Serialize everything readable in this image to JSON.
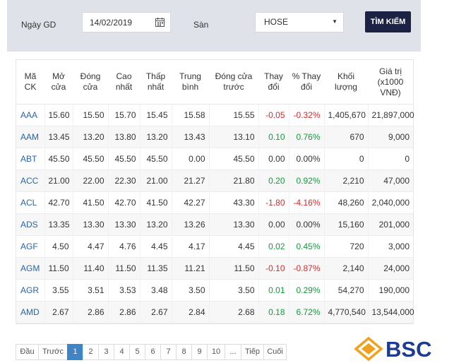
{
  "filter": {
    "date_label": "Ngày GD",
    "date_value": "14/02/2019",
    "exchange_label": "Sàn",
    "exchange_value": "HOSE",
    "search_label": "TÌM KIẾM"
  },
  "table": {
    "headers": [
      "Mã CK",
      "Mở cửa",
      "Đóng cửa",
      "Cao nhất",
      "Thấp nhất",
      "Trung bình",
      "Đóng cửa trước",
      "Thay đổi",
      "% Thay đổi",
      "Khối lượng",
      "Giá trị (x1000 VNĐ)"
    ],
    "rows": [
      {
        "code": "AAA",
        "open": "15.60",
        "close": "15.50",
        "high": "15.70",
        "low": "15.45",
        "avg": "15.58",
        "prev": "15.55",
        "chg": "-0.05",
        "pct": "-0.32%",
        "vol": "1,405,670",
        "val": "21,897,000",
        "dir": "down"
      },
      {
        "code": "AAM",
        "open": "13.45",
        "close": "13.20",
        "high": "13.80",
        "low": "13.20",
        "avg": "13.43",
        "prev": "13.10",
        "chg": "0.10",
        "pct": "0.76%",
        "vol": "670",
        "val": "9,000",
        "dir": "up"
      },
      {
        "code": "ABT",
        "open": "45.50",
        "close": "45.50",
        "high": "45.50",
        "low": "45.50",
        "avg": "0.00",
        "prev": "45.50",
        "chg": "0.00",
        "pct": "0.00%",
        "vol": "0",
        "val": "0",
        "dir": "flat"
      },
      {
        "code": "ACC",
        "open": "21.00",
        "close": "22.00",
        "high": "22.30",
        "low": "21.00",
        "avg": "21.27",
        "prev": "21.80",
        "chg": "0.20",
        "pct": "0.92%",
        "vol": "2,210",
        "val": "47,000",
        "dir": "up"
      },
      {
        "code": "ACL",
        "open": "42.70",
        "close": "41.50",
        "high": "42.70",
        "low": "41.50",
        "avg": "42.27",
        "prev": "43.30",
        "chg": "-1.80",
        "pct": "-4.16%",
        "vol": "48,260",
        "val": "2,040,000",
        "dir": "down"
      },
      {
        "code": "ADS",
        "open": "13.35",
        "close": "13.30",
        "high": "13.30",
        "low": "13.20",
        "avg": "13.26",
        "prev": "13.30",
        "chg": "0.00",
        "pct": "0.00%",
        "vol": "15,160",
        "val": "201,000",
        "dir": "flat"
      },
      {
        "code": "AGF",
        "open": "4.50",
        "close": "4.47",
        "high": "4.76",
        "low": "4.45",
        "avg": "4.17",
        "prev": "4.45",
        "chg": "0.02",
        "pct": "0.45%",
        "vol": "720",
        "val": "3,000",
        "dir": "up"
      },
      {
        "code": "AGM",
        "open": "11.50",
        "close": "11.40",
        "high": "11.50",
        "low": "11.35",
        "avg": "11.21",
        "prev": "11.50",
        "chg": "-0.10",
        "pct": "-0.87%",
        "vol": "2,140",
        "val": "24,000",
        "dir": "down"
      },
      {
        "code": "AGR",
        "open": "3.55",
        "close": "3.51",
        "high": "3.53",
        "low": "3.48",
        "avg": "3.50",
        "prev": "3.50",
        "chg": "0.01",
        "pct": "0.29%",
        "vol": "54,270",
        "val": "190,000",
        "dir": "up"
      },
      {
        "code": "AMD",
        "open": "2.67",
        "close": "2.86",
        "high": "2.86",
        "low": "2.67",
        "avg": "2.84",
        "prev": "2.68",
        "chg": "0.18",
        "pct": "6.72%",
        "vol": "4,770,540",
        "val": "13,544,000",
        "dir": "up"
      }
    ]
  },
  "pagination": {
    "items": [
      "Đầu",
      "Trước",
      "1",
      "2",
      "3",
      "4",
      "5",
      "6",
      "7",
      "8",
      "9",
      "10",
      "...",
      "Tiếp",
      "Cuối"
    ],
    "active": "1"
  },
  "logo": {
    "text": "BSC",
    "color": "#1f3c93",
    "accent": "#f0a21e"
  },
  "colors": {
    "up": "#149a3a",
    "down": "#d22e2e",
    "code": "#2a62a8",
    "button": "#1b2244",
    "active_page": "#3f84c4"
  }
}
